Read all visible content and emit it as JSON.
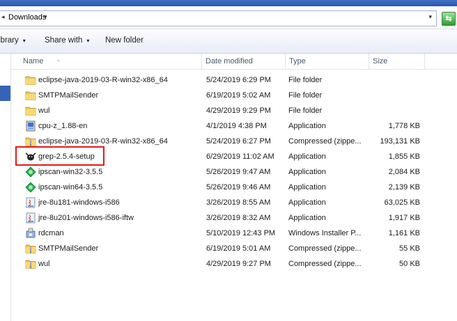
{
  "address": {
    "location": "Downloads",
    "back_arrow": "◂",
    "dropdown_arrow": "▾"
  },
  "toolbar": {
    "library_label": "ibrary",
    "share_label": "Share with",
    "newfolder_label": "New folder",
    "caret": "▾"
  },
  "columns": {
    "name": "Name",
    "date": "Date modified",
    "type": "Type",
    "size": "Size",
    "sort_indicator": "^"
  },
  "highlight_color": "#e11b1b",
  "files": [
    {
      "name": "eclipse-java-2019-03-R-win32-x86_64",
      "date": "5/24/2019 6:29 PM",
      "type": "File folder",
      "size": "",
      "icon": "folder-icon"
    },
    {
      "name": "SMTPMailSender",
      "date": "6/19/2019 5:02 AM",
      "type": "File folder",
      "size": "",
      "icon": "folder-icon"
    },
    {
      "name": "wul",
      "date": "4/29/2019 9:29 PM",
      "type": "File folder",
      "size": "",
      "icon": "folder-icon"
    },
    {
      "name": "cpu-z_1.88-en",
      "date": "4/1/2019 4:38 PM",
      "type": "Application",
      "size": "1,778 KB",
      "icon": "cpuz-app-icon"
    },
    {
      "name": "eclipse-java-2019-03-R-win32-x86_64",
      "date": "5/24/2019 6:27 PM",
      "type": "Compressed (zippe...",
      "size": "193,131 KB",
      "icon": "zip-folder-icon"
    },
    {
      "name": "grep-2.5.4-setup",
      "date": "6/29/2019 11:02 AM",
      "type": "Application",
      "size": "1,855 KB",
      "icon": "gnu-setup-icon"
    },
    {
      "name": "ipscan-win32-3.5.5",
      "date": "5/26/2019 9:47 AM",
      "type": "Application",
      "size": "2,084 KB",
      "icon": "ipscan-icon"
    },
    {
      "name": "ipscan-win64-3.5.5",
      "date": "5/26/2019 9:46 AM",
      "type": "Application",
      "size": "2,139 KB",
      "icon": "ipscan-icon"
    },
    {
      "name": "jre-8u181-windows-i586",
      "date": "3/26/2019 8:55 AM",
      "type": "Application",
      "size": "63,025 KB",
      "icon": "java-installer-icon"
    },
    {
      "name": "jre-8u201-windows-i586-iftw",
      "date": "3/26/2019 8:32 AM",
      "type": "Application",
      "size": "1,917 KB",
      "icon": "java-installer-icon"
    },
    {
      "name": "rdcman",
      "date": "5/10/2019 12:43 PM",
      "type": "Windows Installer P...",
      "size": "1,161 KB",
      "icon": "msi-package-icon"
    },
    {
      "name": "SMTPMailSender",
      "date": "6/19/2019 5:01 AM",
      "type": "Compressed (zippe...",
      "size": "55 KB",
      "icon": "zip-folder-icon"
    },
    {
      "name": "wul",
      "date": "4/29/2019 9:27 PM",
      "type": "Compressed (zippe...",
      "size": "50 KB",
      "icon": "zip-folder-icon"
    }
  ]
}
